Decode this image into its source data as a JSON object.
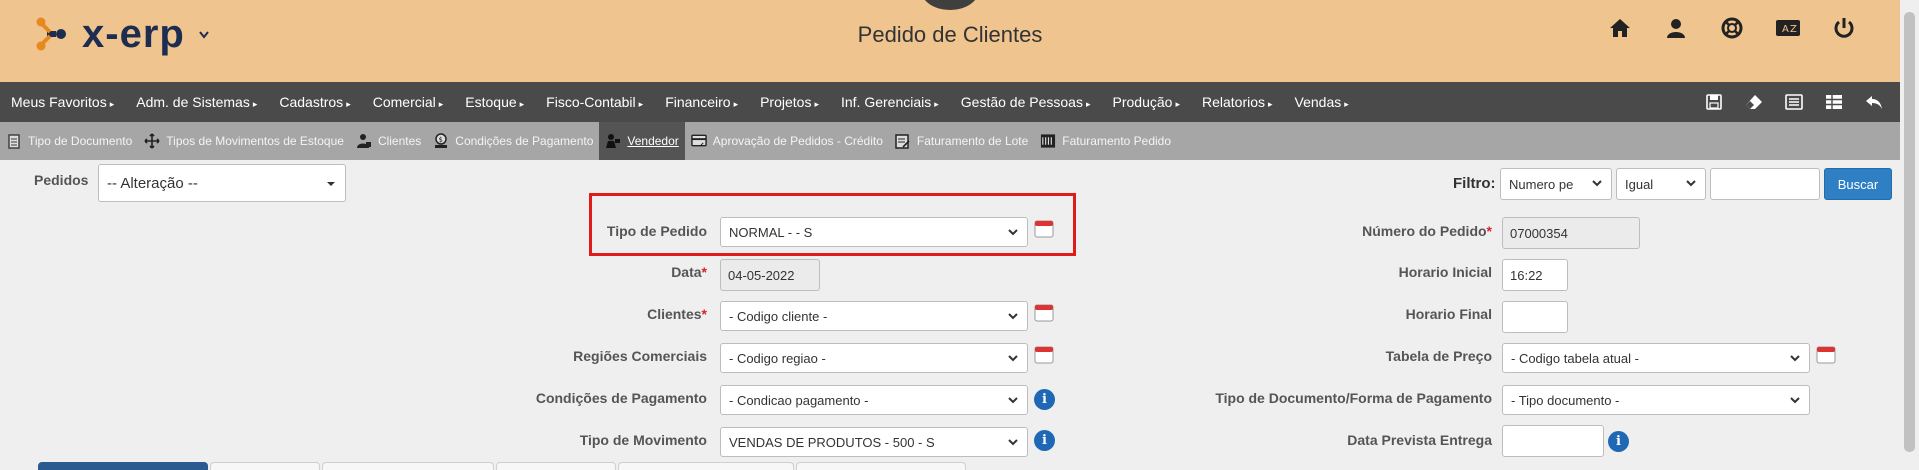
{
  "header": {
    "logo_text": "x-erp",
    "title": "Pedido de Clientes",
    "icons": [
      "home-icon",
      "user-icon",
      "support-icon",
      "translate-icon",
      "power-icon"
    ]
  },
  "menu": {
    "items": [
      "Meus Favoritos",
      "Adm. de Sistemas",
      "Cadastros",
      "Comercial",
      "Estoque",
      "Fisco-Contabil",
      "Financeiro",
      "Projetos",
      "Inf. Gerenciais",
      "Gestão de Pessoas",
      "Produção",
      "Relatorios",
      "Vendas"
    ],
    "right_icons": [
      "save-icon",
      "eraser-icon",
      "list-icon",
      "grid-icon",
      "undo-icon"
    ]
  },
  "subbar": {
    "items": [
      {
        "label": "Tipo de Documento",
        "icon": "document-icon",
        "active": false
      },
      {
        "label": "Tipos de Movimentos de Estoque",
        "icon": "move-icon",
        "active": false
      },
      {
        "label": "Clientes",
        "icon": "client-icon",
        "active": false
      },
      {
        "label": "Condições de Pagamento",
        "icon": "payment-icon",
        "active": false
      },
      {
        "label": "Vendedor",
        "icon": "seller-icon",
        "active": true
      },
      {
        "label": "Aprovação de Pedidos - Crédito",
        "icon": "card-icon",
        "active": false
      },
      {
        "label": "Faturamento de Lote",
        "icon": "batch-icon",
        "active": false
      },
      {
        "label": "Faturamento Pedido",
        "icon": "invoice-icon",
        "active": false
      }
    ]
  },
  "toolbar": {
    "pedidos_label": "Pedidos",
    "pedidos_value": "-- Alteração --",
    "filtro_label": "Filtro:",
    "filtro_field": "Numero pe",
    "filtro_op": "Igual",
    "filtro_value": "",
    "buscar_label": "Buscar"
  },
  "form_left": {
    "tipo_pedido": {
      "label": "Tipo de Pedido",
      "value": "NORMAL - - S"
    },
    "data": {
      "label": "Data",
      "value": "04-05-2022"
    },
    "clientes": {
      "label": "Clientes",
      "value": "- Codigo cliente -"
    },
    "regioes": {
      "label": "Regiões Comerciais",
      "value": "- Codigo regiao -"
    },
    "condicoes": {
      "label": "Condições de Pagamento",
      "value": "- Condicao pagamento -"
    },
    "tipo_movimento": {
      "label": "Tipo de Movimento",
      "value": "VENDAS DE PRODUTOS - 500 - S"
    }
  },
  "form_right": {
    "numero_pedido": {
      "label": "Número do Pedido",
      "value": "07000354"
    },
    "horario_inicial": {
      "label": "Horario Inicial",
      "value": "16:22"
    },
    "horario_final": {
      "label": "Horario Final",
      "value": ""
    },
    "tabela_preco": {
      "label": "Tabela de Preço",
      "value": "- Codigo tabela atual -"
    },
    "tipo_documento": {
      "label": "Tipo de Documento/Forma de Pagamento",
      "value": "- Tipo documento -"
    },
    "data_prevista": {
      "label": "Data Prevista Entrega",
      "value": ""
    }
  },
  "required_mark": "*",
  "info_glyph": "i",
  "colors": {
    "header_bg": "#efc48f",
    "menu_bg": "#4a4a4a",
    "subbar_bg": "#a6a6a6",
    "active_tab": "#545454",
    "highlight": "#e11a1a",
    "button": "#2f7fc4"
  }
}
